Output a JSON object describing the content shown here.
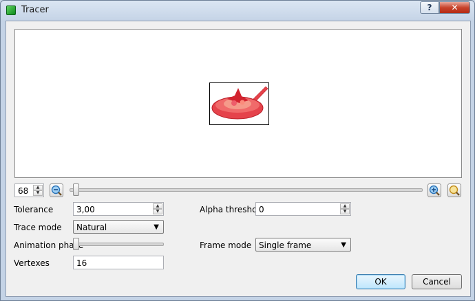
{
  "window": {
    "title": "Tracer",
    "help_glyph": "?",
    "close_glyph": "✕"
  },
  "zoom": {
    "value": "68",
    "zoom_out_icon": "zoom-out-icon",
    "zoom_in_icon": "zoom-in-icon",
    "zoom_fit_icon": "zoom-fit-icon",
    "slider_level": 0.01
  },
  "tolerance": {
    "label": "Tolerance",
    "value": "3,00"
  },
  "alpha_threshold": {
    "label": "Alpha threshold",
    "value": "0"
  },
  "trace_mode": {
    "label": "Trace mode",
    "value": "Natural"
  },
  "animation_phase": {
    "label": "Animation phase",
    "slider_level": 0.0
  },
  "frame_mode": {
    "label": "Frame mode",
    "value": "Single frame"
  },
  "vertexes": {
    "label": "Vertexes",
    "value": "16"
  },
  "buttons": {
    "ok": "OK",
    "cancel": "Cancel"
  },
  "colors": {
    "accent": "#3c7fb1",
    "pan": "#e5434b",
    "food": "#f27a6a"
  }
}
